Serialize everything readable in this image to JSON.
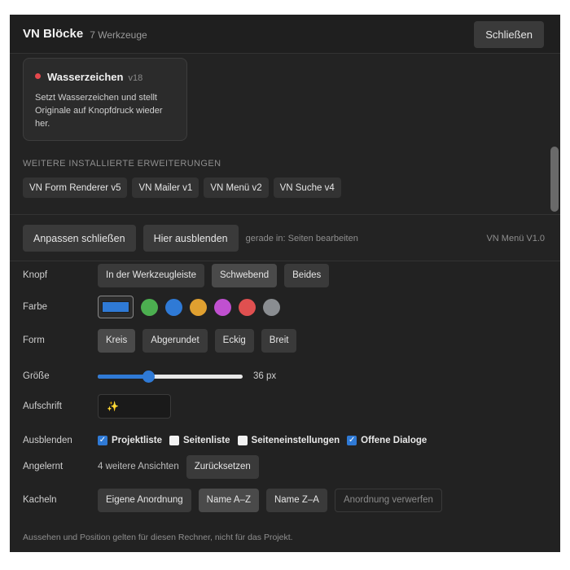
{
  "header": {
    "title": "VN Blöcke",
    "count": "7 Werkzeuge",
    "close_label": "Schließen"
  },
  "card": {
    "name": "Wasserzeichen",
    "version": "v18",
    "description": "Setzt Wasserzeichen und stellt Originale auf Knopfdruck wieder her.",
    "status_color": "#e5484d"
  },
  "extensions": {
    "label": "WEITERE INSTALLIERTE ERWEITERUNGEN",
    "items": [
      "VN Form Renderer v5",
      "VN Mailer v1",
      "VN Menü v2",
      "VN Suche v4"
    ]
  },
  "toolbar": {
    "close_customize": "Anpassen schließen",
    "hide_here": "Hier ausblenden",
    "context": "gerade in: Seiten bearbeiten",
    "module_version": "VN Menü V1.0"
  },
  "settings": {
    "button": {
      "label": "Knopf",
      "options": [
        "In der Werkzeugleiste",
        "Schwebend",
        "Beides"
      ],
      "selected": "Schwebend"
    },
    "color": {
      "label": "Farbe",
      "current": "#2f7ad6",
      "options": [
        "#4caf50",
        "#2f7ad6",
        "#e0a030",
        "#c050d0",
        "#e05050",
        "#8a8d91"
      ]
    },
    "shape": {
      "label": "Form",
      "options": [
        "Kreis",
        "Abgerundet",
        "Eckig",
        "Breit"
      ],
      "selected": "Kreis"
    },
    "size": {
      "label": "Größe",
      "value": 36,
      "unit": "px",
      "display": "36 px",
      "fraction": 0.35
    },
    "caption": {
      "label": "Aufschrift",
      "value": "✨"
    },
    "hide": {
      "label": "Ausblenden",
      "items": [
        {
          "label": "Projektliste",
          "checked": true
        },
        {
          "label": "Seitenliste",
          "checked": false
        },
        {
          "label": "Seiteneinstellungen",
          "checked": false
        },
        {
          "label": "Offene Dialoge",
          "checked": true
        }
      ]
    },
    "learned": {
      "label": "Angelernt",
      "text": "4 weitere Ansichten",
      "reset_label": "Zurücksetzen"
    },
    "tiles": {
      "label": "Kacheln",
      "options": [
        "Eigene Anordnung",
        "Name A–Z",
        "Name Z–A"
      ],
      "selected": "Name A–Z",
      "discard_label": "Anordnung verwerfen"
    }
  },
  "footer": "Aussehen und Position gelten für diesen Rechner, nicht für das Projekt."
}
